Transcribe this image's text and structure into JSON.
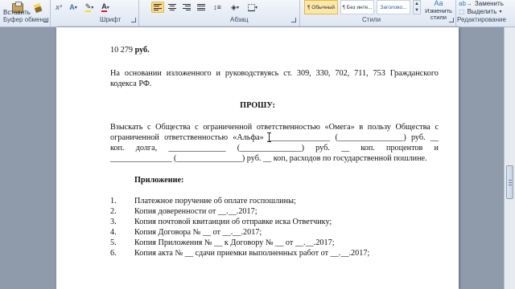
{
  "ribbon": {
    "clipboard": {
      "paste_label": "Вставить",
      "group_label": "Буфер обмена"
    },
    "font": {
      "group_label": "Шрифт"
    },
    "paragraph": {
      "group_label": "Абзац"
    },
    "styles": {
      "group_label": "Стили",
      "items": [
        "¶ Обычный",
        "¶ Без инте...",
        "Заголово..."
      ],
      "selected": "¶ Обычный",
      "change_styles_label": "Изменить стили"
    },
    "editing": {
      "group_label": "Редактирование",
      "replace_label": "Заменить",
      "select_label": "Выделить"
    }
  },
  "document": {
    "amount_number": "10 279",
    "amount_unit": "руб.",
    "basis_line1_words": [
      "На",
      "основании",
      "изложенного",
      "и",
      "руководствуясь",
      "ст.",
      "309,",
      "330,",
      "702,",
      "711,",
      "753",
      "Гражданского"
    ],
    "basis_line2": "кодекса РФ.",
    "heading": "ПРОШУ:",
    "request_line1_words": [
      "Взыскать",
      "с",
      "Общества",
      "с",
      "ограниченной",
      "ответственностью",
      "«Омега»",
      "в",
      "пользу",
      "Общества",
      "с"
    ],
    "request_line2_words": [
      "ограниченной",
      "ответственностью",
      "«Альфа»",
      "_______________",
      "(________________)",
      "руб.",
      "__"
    ],
    "request_line3_words": [
      "коп.",
      "долга,",
      "______________",
      "(_______________)",
      "руб.",
      "__",
      "коп.",
      "процентов",
      "и"
    ],
    "request_line4": "_______________ (________________) руб. __ коп, расходов по государственной пошлине.",
    "attachments_title": "Приложение:",
    "attachments": [
      {
        "num": "1.",
        "text": "Платежное поручение об оплате госпошлины;"
      },
      {
        "num": "2.",
        "text": "Копия доверенности от __.__.2017;"
      },
      {
        "num": "3.",
        "text": "Копия почтовой квитанции об отправке иска Ответчику;"
      },
      {
        "num": "4.",
        "text": "Копия Договора № __ от __.__.2017;"
      },
      {
        "num": "5.",
        "text": "Копия Приложения № __ к Договору № __ от __.__.2017;"
      },
      {
        "num": "6.",
        "text": "Копия акта № __ сдачи приемки выполненных работ от __.__.2017;"
      }
    ]
  },
  "colors": {
    "ribbon_top": "#f3f6fb",
    "ribbon_bottom": "#dde6f2",
    "workspace": "#8f9aab",
    "page": "#ffffff",
    "selected_style": "#fde7a6"
  }
}
